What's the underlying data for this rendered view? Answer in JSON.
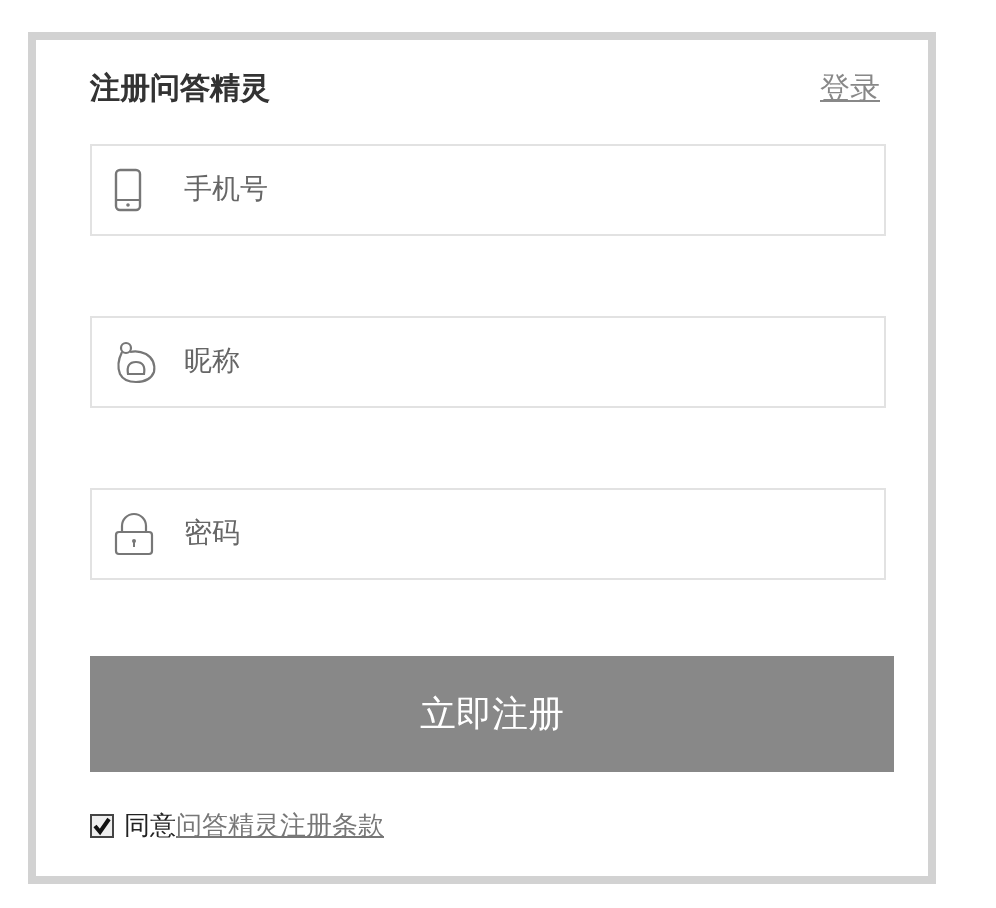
{
  "title": "注册问答精灵",
  "login_link": "登录",
  "fields": [
    {
      "kind": "phone",
      "placeholder": "手机号"
    },
    {
      "kind": "user",
      "placeholder": "昵称"
    },
    {
      "kind": "lock",
      "placeholder": "密码"
    }
  ],
  "submit_button": "立即注册",
  "agreement": {
    "checked": true,
    "label": "同意",
    "link": "问答精灵注册条款"
  }
}
